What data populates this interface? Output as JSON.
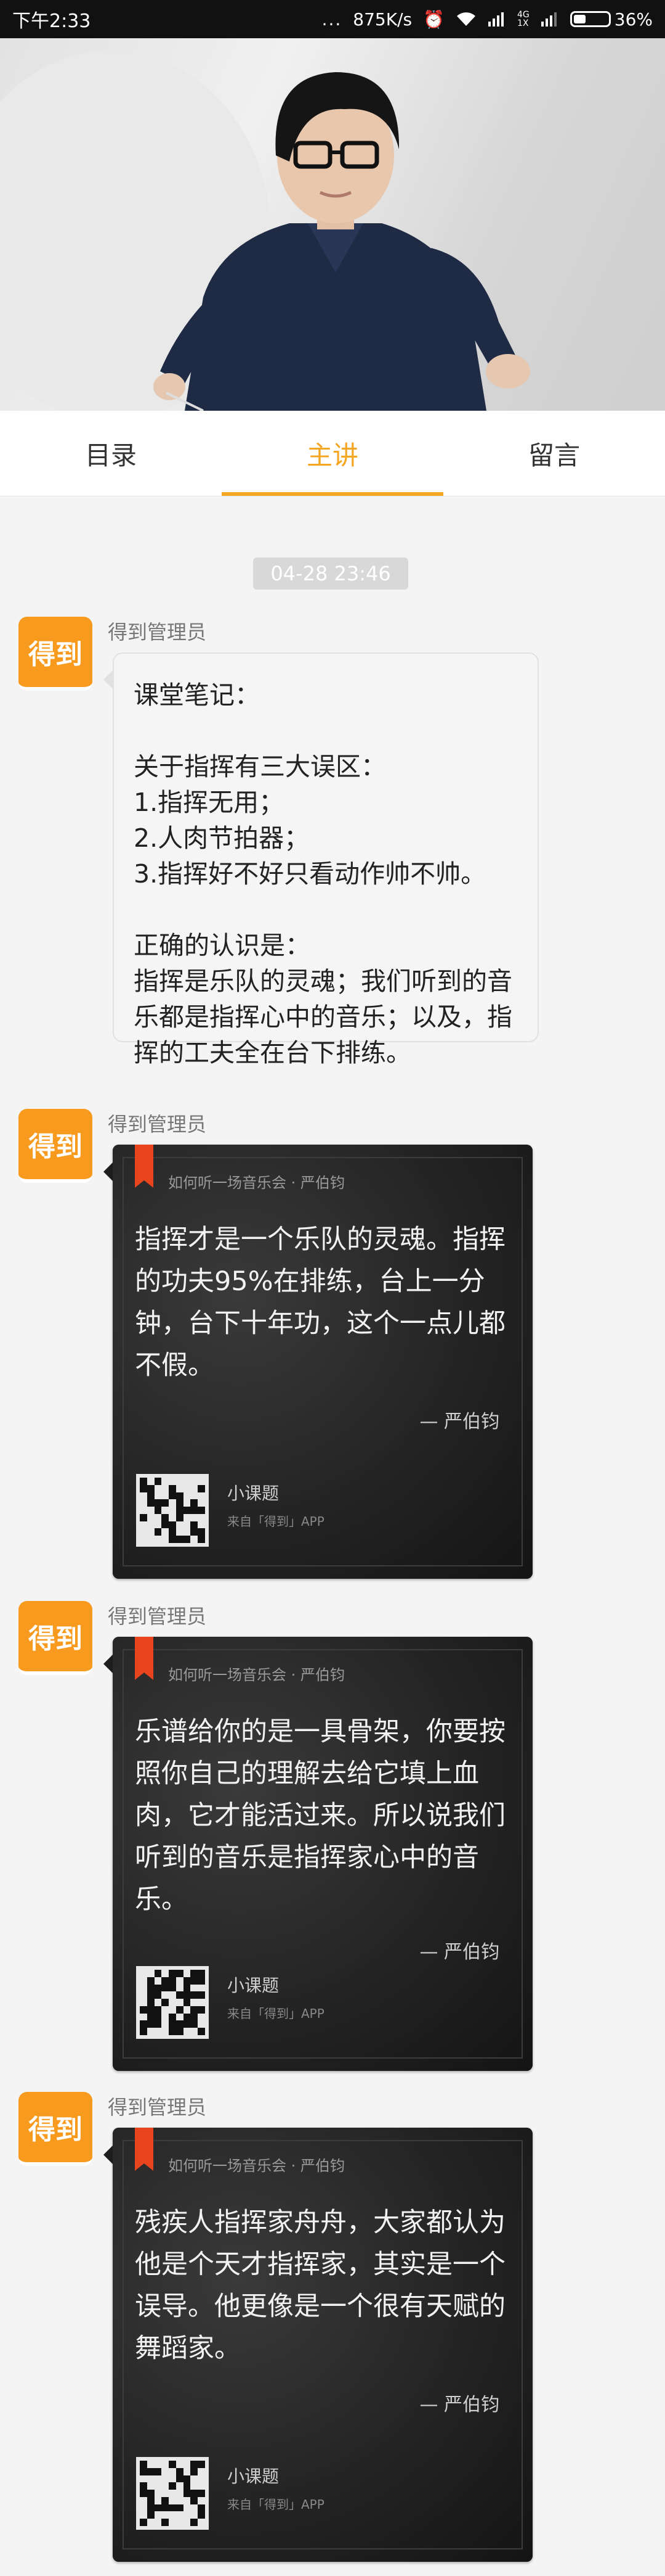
{
  "status_bar": {
    "time": "下午2:33",
    "dots": "...",
    "speed": "875K/s",
    "network_label": "4G\n1X",
    "battery": "36%",
    "battery_level": 0.36
  },
  "tabs": [
    {
      "label": "目录",
      "active": false
    },
    {
      "label": "主讲",
      "active": true
    },
    {
      "label": "留言",
      "active": false
    }
  ],
  "feed": {
    "timestamp": "04-28 23:46",
    "avatar_text": "得到",
    "sender": "得到管理员",
    "text_message": "课堂笔记：\n\n关于指挥有三大误区：\n1.指挥无用；\n2.人肉节拍器；\n3.指挥好不好只看动作帅不帅。\n\n正确的认识是：\n指挥是乐队的灵魂；我们听到的音乐都是指挥心中的音乐；以及，指挥的工夫全在台下排练。",
    "cards": [
      {
        "source": "如何听一场音乐会 · 严伯钧",
        "quote": "指挥才是一个乐队的灵魂。指挥的功夫95%在排练，台上一分钟，台下十年功，这个一点儿都不假。",
        "author": "— 严伯钧",
        "title": "小课题",
        "from": "来自「得到」APP"
      },
      {
        "source": "如何听一场音乐会 · 严伯钧",
        "quote": "乐谱给你的是一具骨架，你要按照你自己的理解去给它填上血肉，它才能活过来。所以说我们听到的音乐是指挥家心中的音乐。",
        "author": "— 严伯钧",
        "title": "小课题",
        "from": "来自「得到」APP"
      },
      {
        "source": "如何听一场音乐会 · 严伯钧",
        "quote": "残疾人指挥家舟舟，大家都认为他是个天才指挥家，其实是一个误导。他更像是一个很有天赋的舞蹈家。",
        "author": "— 严伯钧",
        "title": "小课题",
        "from": "来自「得到」APP"
      }
    ]
  },
  "colors": {
    "accent": "#f5a623",
    "avatar": "#f79a1e",
    "ribbon": "#e8451e"
  }
}
